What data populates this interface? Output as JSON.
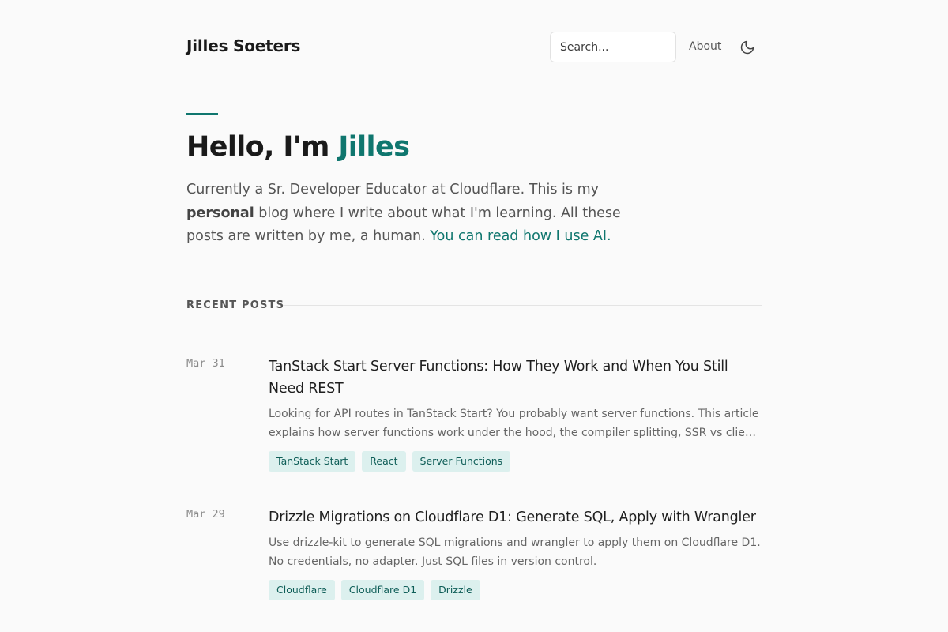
{
  "header": {
    "site_title": "Jilles Soeters",
    "search_placeholder": "Search...",
    "about_label": "About",
    "theme_icon": "moon-icon"
  },
  "hero": {
    "greeting": "Hello, I'm ",
    "name": "Jilles",
    "intro_before": "Currently a Sr. Developer Educator at Cloudflare. This is my ",
    "intro_bold": "personal",
    "intro_after": " blog where I write about what I'm learning. All these posts are written by me, a human. ",
    "ai_link": "You can read how I use AI."
  },
  "recent": {
    "label": "RECENT POSTS",
    "posts": [
      {
        "date": "Mar 31",
        "title": "TanStack Start Server Functions: How They Work and When You Still Need REST",
        "excerpt": "Looking for API routes in TanStack Start? You probably want server functions. This article explains how server functions work under the hood, the compiler splitting, SSR vs client RPC,...",
        "tags": [
          "TanStack Start",
          "React",
          "Server Functions"
        ]
      },
      {
        "date": "Mar 29",
        "title": "Drizzle Migrations on Cloudflare D1: Generate SQL, Apply with Wrangler",
        "excerpt": "Use drizzle-kit to generate SQL migrations and wrangler to apply them on Cloudflare D1. No credentials, no adapter. Just SQL files in version control.",
        "tags": [
          "Cloudflare",
          "Cloudflare D1",
          "Drizzle"
        ]
      }
    ]
  },
  "colors": {
    "accent": "#0f766e",
    "tag_bg": "#dcf0ee",
    "background": "#fafafa"
  }
}
